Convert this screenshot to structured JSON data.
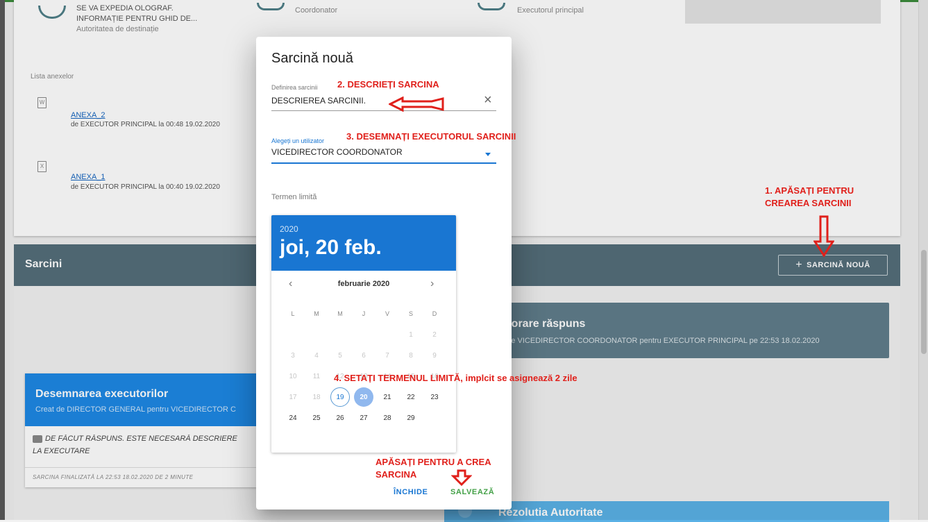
{
  "background": {
    "top_card": {
      "row1": {
        "a_line1": "SE VA EXPEDIA OLOGRAF.",
        "a_line2": "INFORMAȚIE PENTRU GHID DE...",
        "a_sub": "Autoritatea de destinație",
        "b_sub": "Coordonator",
        "c_sub": "Executorul principal"
      },
      "annex_heading": "Lista anexelor",
      "annexes": [
        {
          "name": "ANEXA_2",
          "meta": "de EXECUTOR PRINCIPAL la 00:48 19.02.2020",
          "icon": "word-file-icon",
          "glyph": "W"
        },
        {
          "name": "ANEXA_1",
          "meta": "de EXECUTOR PRINCIPAL la 00:40 19.02.2020",
          "icon": "excel-file-icon",
          "glyph": "X"
        }
      ]
    },
    "tasks_section": {
      "title": "Sarcini",
      "new_button": "SARCINĂ NOUĂ",
      "new_button_icon": "+"
    },
    "task_grey": {
      "title": "aborare răspuns",
      "sub": "at de VICEDIRECTOR COORDONATOR pentru EXECUTOR PRINCIPAL pe 22:53 18.02.2020"
    },
    "task_blue": {
      "title": "Desemnarea executorilor",
      "sub": "Creat de DIRECTOR GENERAL pentru VICEDIRECTOR C",
      "comment_l1": "DE FĂCUT RĂSPUNS. ESTE NECESARĂ DESCRIERE",
      "comment_l2": "LA EXECUTARE",
      "footer": "SARCINA FINALIZATĂ LA 22:53 18.02.2020 DE 2 MINUTE"
    },
    "task_bottom": {
      "title": "Rezolutia Autoritate"
    }
  },
  "dialog": {
    "title": "Sarcină nouă",
    "definition_label": "Definirea sarcinii",
    "definition_value": "DESCRIEREA SARCINII.",
    "clear_icon": "×",
    "user_label": "Alegeți un utilizator",
    "user_value": "VICEDIRECTOR COORDONATOR",
    "deadline_label": "Termen limită",
    "datepicker": {
      "year": "2020",
      "selected_label": "joi, 20 feb.",
      "month_label": "februarie 2020",
      "prev": "‹",
      "next": "›",
      "weekdays": [
        "L",
        "M",
        "M",
        "J",
        "V",
        "S",
        "D"
      ],
      "weeks": [
        [
          "",
          "",
          "",
          "",
          "",
          "1",
          "2"
        ],
        [
          "3",
          "4",
          "5",
          "6",
          "7",
          "8",
          "9"
        ],
        [
          "10",
          "11",
          "12",
          "13",
          "14",
          "15",
          "16"
        ],
        [
          "17",
          "18",
          "19",
          "20",
          "21",
          "22",
          "23"
        ],
        [
          "24",
          "25",
          "26",
          "27",
          "28",
          "29",
          ""
        ]
      ],
      "today": "19",
      "selected": "20",
      "disabled_before": 19
    },
    "close_button": "ÎNCHIDE",
    "save_button": "SALVEAZĂ"
  },
  "annotations": {
    "step1_l1": "1. APĂSAȚI PENTRU",
    "step1_l2": "CREAREA SARCINII",
    "step2": "2. DESCRIEȚI SARCINA",
    "step3": "3. DESEMNAȚI EXECUTORUL SARCINII",
    "step4": "4. SETAȚI TERMENUL LIMITĂ, implcit se asignează 2 zile",
    "save_l1": "APĂSAȚI PENTRU A CREA",
    "save_l2": "SARCINA"
  },
  "colors": {
    "primary": "#1976d2",
    "annotation": "#e0201b",
    "section_bar": "#546e7a",
    "save": "#43a047"
  }
}
